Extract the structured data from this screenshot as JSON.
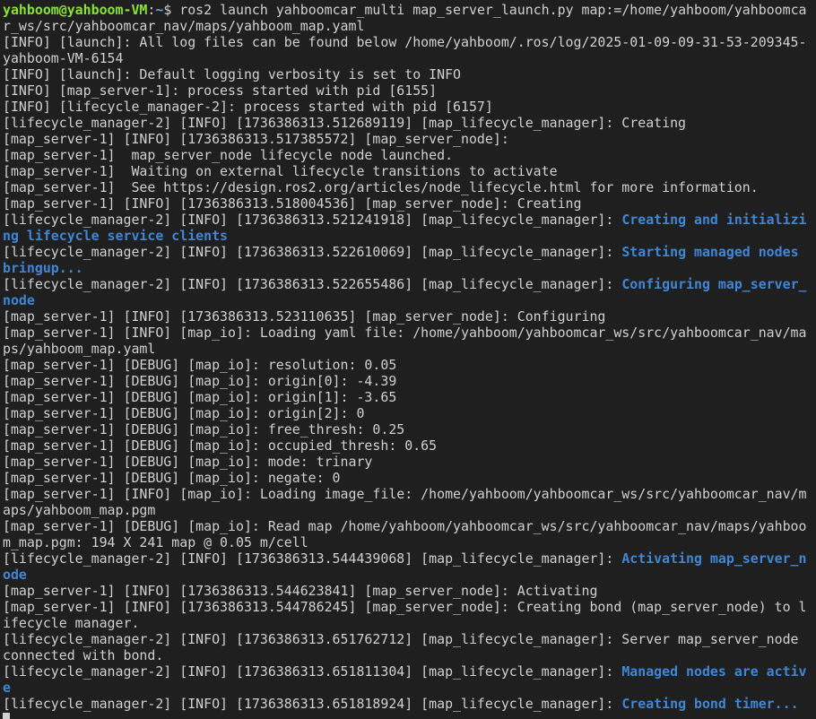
{
  "prompt": {
    "user_host": "yahboom@yahboom-VM",
    "sep": ":",
    "path": "~",
    "symbol": "$ ",
    "command": "ros2 launch yahboomcar_multi map_server_launch.py map:=/home/yahboom/yahboomca"
  },
  "lines": [
    {
      "t": "r_ws/src/yahboomcar_nav/maps/yahboom_map.yaml"
    },
    {
      "t": "[INFO] [launch]: All log files can be found below /home/yahboom/.ros/log/2025-01-09-09-31-53-209345-"
    },
    {
      "t": "yahboom-VM-6154"
    },
    {
      "t": "[INFO] [launch]: Default logging verbosity is set to INFO"
    },
    {
      "t": "[INFO] [map_server-1]: process started with pid [6155]"
    },
    {
      "t": "[INFO] [lifecycle_manager-2]: process started with pid [6157]"
    },
    {
      "t": "[lifecycle_manager-2] [INFO] [1736386313.512689119] [map_lifecycle_manager]: Creating"
    },
    {
      "t": "[map_server-1] [INFO] [1736386313.517385572] [map_server_node]:"
    },
    {
      "t": "[map_server-1]  map_server_node lifecycle node launched."
    },
    {
      "t": "[map_server-1]  Waiting on external lifecycle transitions to activate"
    },
    {
      "t": "[map_server-1]  See https://design.ros2.org/articles/node_lifecycle.html for more information."
    },
    {
      "t": "[map_server-1] [INFO] [1736386313.518004536] [map_server_node]: Creating"
    },
    {
      "t": "[lifecycle_manager-2] [INFO] [1736386313.521241918] [map_lifecycle_manager]: ",
      "h": "Creating and initializi"
    },
    {
      "t": "",
      "h": "ng lifecycle service clients"
    },
    {
      "t": "[lifecycle_manager-2] [INFO] [1736386313.522610069] [map_lifecycle_manager]: ",
      "h": "Starting managed nodes "
    },
    {
      "t": "",
      "h": "bringup..."
    },
    {
      "t": "[lifecycle_manager-2] [INFO] [1736386313.522655486] [map_lifecycle_manager]: ",
      "h": "Configuring map_server_"
    },
    {
      "t": "",
      "h": "node"
    },
    {
      "t": "[map_server-1] [INFO] [1736386313.523110635] [map_server_node]: Configuring"
    },
    {
      "t": "[map_server-1] [INFO] [map_io]: Loading yaml file: /home/yahboom/yahboomcar_ws/src/yahboomcar_nav/ma"
    },
    {
      "t": "ps/yahboom_map.yaml"
    },
    {
      "t": "[map_server-1] [DEBUG] [map_io]: resolution: 0.05"
    },
    {
      "t": "[map_server-1] [DEBUG] [map_io]: origin[0]: -4.39"
    },
    {
      "t": "[map_server-1] [DEBUG] [map_io]: origin[1]: -3.65"
    },
    {
      "t": "[map_server-1] [DEBUG] [map_io]: origin[2]: 0"
    },
    {
      "t": "[map_server-1] [DEBUG] [map_io]: free_thresh: 0.25"
    },
    {
      "t": "[map_server-1] [DEBUG] [map_io]: occupied_thresh: 0.65"
    },
    {
      "t": "[map_server-1] [DEBUG] [map_io]: mode: trinary"
    },
    {
      "t": "[map_server-1] [DEBUG] [map_io]: negate: 0"
    },
    {
      "t": "[map_server-1] [INFO] [map_io]: Loading image_file: /home/yahboom/yahboomcar_ws/src/yahboomcar_nav/m"
    },
    {
      "t": "aps/yahboom_map.pgm"
    },
    {
      "t": "[map_server-1] [DEBUG] [map_io]: Read map /home/yahboom/yahboomcar_ws/src/yahboomcar_nav/maps/yahboo"
    },
    {
      "t": "m_map.pgm: 194 X 241 map @ 0.05 m/cell"
    },
    {
      "t": "[lifecycle_manager-2] [INFO] [1736386313.544439068] [map_lifecycle_manager]: ",
      "h": "Activating map_server_n"
    },
    {
      "t": "",
      "h": "ode"
    },
    {
      "t": "[map_server-1] [INFO] [1736386313.544623841] [map_server_node]: Activating"
    },
    {
      "t": "[map_server-1] [INFO] [1736386313.544786245] [map_server_node]: Creating bond (map_server_node) to l"
    },
    {
      "t": "ifecycle manager."
    },
    {
      "t": "[lifecycle_manager-2] [INFO] [1736386313.651762712] [map_lifecycle_manager]: Server map_server_node "
    },
    {
      "t": "connected with bond."
    },
    {
      "t": "[lifecycle_manager-2] [INFO] [1736386313.651811304] [map_lifecycle_manager]: ",
      "h": "Managed nodes are activ"
    },
    {
      "t": "",
      "h": "e"
    },
    {
      "t": "[lifecycle_manager-2] [INFO] [1736386313.651818924] [map_lifecycle_manager]: ",
      "h": "Creating bond timer..."
    }
  ],
  "colors": {
    "background": "#1f1f1f",
    "text": "#d0d0d0",
    "user": "#8ae234",
    "path": "#729fcf",
    "highlight": "#3f86d6"
  }
}
